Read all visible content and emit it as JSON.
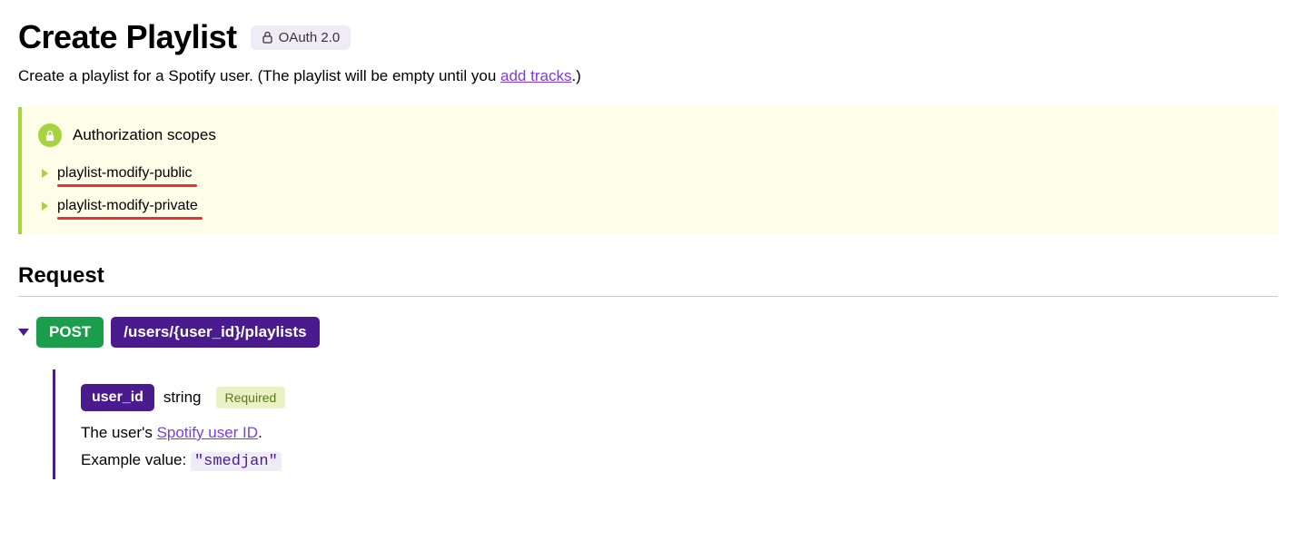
{
  "header": {
    "title": "Create Playlist",
    "oauth_badge": "OAuth 2.0"
  },
  "description": {
    "prefix": "Create a playlist for a Spotify user. (The playlist will be empty until you ",
    "link_text": "add tracks",
    "suffix": ".)"
  },
  "auth": {
    "title": "Authorization scopes",
    "scopes": [
      "playlist-modify-public",
      "playlist-modify-private"
    ]
  },
  "request": {
    "heading": "Request",
    "method": "POST",
    "path": "/users/{user_id}/playlists",
    "param": {
      "name": "user_id",
      "type": "string",
      "required_label": "Required",
      "desc_prefix": "The user's ",
      "desc_link": "Spotify user ID",
      "desc_suffix": ".",
      "example_label": "Example value: ",
      "example_value": "\"smedjan\""
    }
  }
}
